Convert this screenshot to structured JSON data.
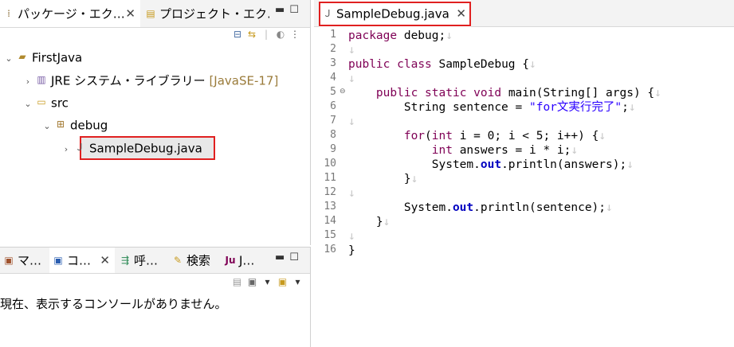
{
  "explorer": {
    "tabs": [
      {
        "label": "パッケージ・エク…",
        "icon": "package-explorer-icon",
        "active": true
      },
      {
        "label": "プロジェクト・エク…",
        "icon": "project-explorer-icon",
        "active": false
      }
    ],
    "close_glyph": "✕",
    "tree": [
      {
        "label": "FirstJava",
        "decoration": "",
        "twisty": "open",
        "icon": "project-icon"
      },
      {
        "label": "JRE システム・ライブラリー",
        "decoration": "[JavaSE-17]",
        "twisty": "closed",
        "icon": "library-icon"
      },
      {
        "label": "src",
        "decoration": "",
        "twisty": "open",
        "icon": "source-folder-icon"
      },
      {
        "label": "debug",
        "decoration": "",
        "twisty": "open",
        "icon": "package-icon"
      },
      {
        "label": "SampleDebug.java",
        "decoration": "",
        "twisty": "closed",
        "icon": "java-file-icon",
        "selected": true
      }
    ]
  },
  "bottom_panel": {
    "tabs": [
      {
        "label": "マ…",
        "icon": "markers-icon"
      },
      {
        "label": "コ…",
        "icon": "console-icon",
        "active": true
      },
      {
        "label": "呼…",
        "icon": "call-hierarchy-icon"
      },
      {
        "label": "検索",
        "icon": "search-icon"
      },
      {
        "label": "J…",
        "icon": "junit-icon"
      }
    ],
    "message": "現在、表示するコンソールがありません。"
  },
  "editor": {
    "tab_label": "SampleDebug.java",
    "line_numbers": [
      "1",
      "2",
      "3",
      "4",
      "5",
      "6",
      "7",
      "8",
      "9",
      "10",
      "11",
      "12",
      "13",
      "14",
      "15",
      "16"
    ],
    "line_end_marker": "↓"
  }
}
